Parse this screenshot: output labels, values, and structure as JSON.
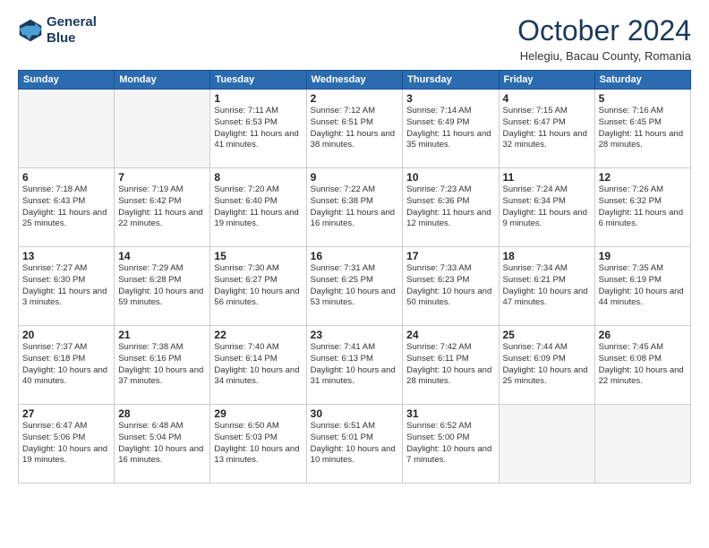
{
  "logo": {
    "line1": "General",
    "line2": "Blue"
  },
  "title": "October 2024",
  "subtitle": "Helegiu, Bacau County, Romania",
  "days_header": [
    "Sunday",
    "Monday",
    "Tuesday",
    "Wednesday",
    "Thursday",
    "Friday",
    "Saturday"
  ],
  "weeks": [
    [
      {
        "num": "",
        "info": ""
      },
      {
        "num": "",
        "info": ""
      },
      {
        "num": "1",
        "info": "Sunrise: 7:11 AM\nSunset: 6:53 PM\nDaylight: 11 hours and 41 minutes."
      },
      {
        "num": "2",
        "info": "Sunrise: 7:12 AM\nSunset: 6:51 PM\nDaylight: 11 hours and 38 minutes."
      },
      {
        "num": "3",
        "info": "Sunrise: 7:14 AM\nSunset: 6:49 PM\nDaylight: 11 hours and 35 minutes."
      },
      {
        "num": "4",
        "info": "Sunrise: 7:15 AM\nSunset: 6:47 PM\nDaylight: 11 hours and 32 minutes."
      },
      {
        "num": "5",
        "info": "Sunrise: 7:16 AM\nSunset: 6:45 PM\nDaylight: 11 hours and 28 minutes."
      }
    ],
    [
      {
        "num": "6",
        "info": "Sunrise: 7:18 AM\nSunset: 6:43 PM\nDaylight: 11 hours and 25 minutes."
      },
      {
        "num": "7",
        "info": "Sunrise: 7:19 AM\nSunset: 6:42 PM\nDaylight: 11 hours and 22 minutes."
      },
      {
        "num": "8",
        "info": "Sunrise: 7:20 AM\nSunset: 6:40 PM\nDaylight: 11 hours and 19 minutes."
      },
      {
        "num": "9",
        "info": "Sunrise: 7:22 AM\nSunset: 6:38 PM\nDaylight: 11 hours and 16 minutes."
      },
      {
        "num": "10",
        "info": "Sunrise: 7:23 AM\nSunset: 6:36 PM\nDaylight: 11 hours and 12 minutes."
      },
      {
        "num": "11",
        "info": "Sunrise: 7:24 AM\nSunset: 6:34 PM\nDaylight: 11 hours and 9 minutes."
      },
      {
        "num": "12",
        "info": "Sunrise: 7:26 AM\nSunset: 6:32 PM\nDaylight: 11 hours and 6 minutes."
      }
    ],
    [
      {
        "num": "13",
        "info": "Sunrise: 7:27 AM\nSunset: 6:30 PM\nDaylight: 11 hours and 3 minutes."
      },
      {
        "num": "14",
        "info": "Sunrise: 7:29 AM\nSunset: 6:28 PM\nDaylight: 10 hours and 59 minutes."
      },
      {
        "num": "15",
        "info": "Sunrise: 7:30 AM\nSunset: 6:27 PM\nDaylight: 10 hours and 56 minutes."
      },
      {
        "num": "16",
        "info": "Sunrise: 7:31 AM\nSunset: 6:25 PM\nDaylight: 10 hours and 53 minutes."
      },
      {
        "num": "17",
        "info": "Sunrise: 7:33 AM\nSunset: 6:23 PM\nDaylight: 10 hours and 50 minutes."
      },
      {
        "num": "18",
        "info": "Sunrise: 7:34 AM\nSunset: 6:21 PM\nDaylight: 10 hours and 47 minutes."
      },
      {
        "num": "19",
        "info": "Sunrise: 7:35 AM\nSunset: 6:19 PM\nDaylight: 10 hours and 44 minutes."
      }
    ],
    [
      {
        "num": "20",
        "info": "Sunrise: 7:37 AM\nSunset: 6:18 PM\nDaylight: 10 hours and 40 minutes."
      },
      {
        "num": "21",
        "info": "Sunrise: 7:38 AM\nSunset: 6:16 PM\nDaylight: 10 hours and 37 minutes."
      },
      {
        "num": "22",
        "info": "Sunrise: 7:40 AM\nSunset: 6:14 PM\nDaylight: 10 hours and 34 minutes."
      },
      {
        "num": "23",
        "info": "Sunrise: 7:41 AM\nSunset: 6:13 PM\nDaylight: 10 hours and 31 minutes."
      },
      {
        "num": "24",
        "info": "Sunrise: 7:42 AM\nSunset: 6:11 PM\nDaylight: 10 hours and 28 minutes."
      },
      {
        "num": "25",
        "info": "Sunrise: 7:44 AM\nSunset: 6:09 PM\nDaylight: 10 hours and 25 minutes."
      },
      {
        "num": "26",
        "info": "Sunrise: 7:45 AM\nSunset: 6:08 PM\nDaylight: 10 hours and 22 minutes."
      }
    ],
    [
      {
        "num": "27",
        "info": "Sunrise: 6:47 AM\nSunset: 5:06 PM\nDaylight: 10 hours and 19 minutes."
      },
      {
        "num": "28",
        "info": "Sunrise: 6:48 AM\nSunset: 5:04 PM\nDaylight: 10 hours and 16 minutes."
      },
      {
        "num": "29",
        "info": "Sunrise: 6:50 AM\nSunset: 5:03 PM\nDaylight: 10 hours and 13 minutes."
      },
      {
        "num": "30",
        "info": "Sunrise: 6:51 AM\nSunset: 5:01 PM\nDaylight: 10 hours and 10 minutes."
      },
      {
        "num": "31",
        "info": "Sunrise: 6:52 AM\nSunset: 5:00 PM\nDaylight: 10 hours and 7 minutes."
      },
      {
        "num": "",
        "info": ""
      },
      {
        "num": "",
        "info": ""
      }
    ]
  ]
}
